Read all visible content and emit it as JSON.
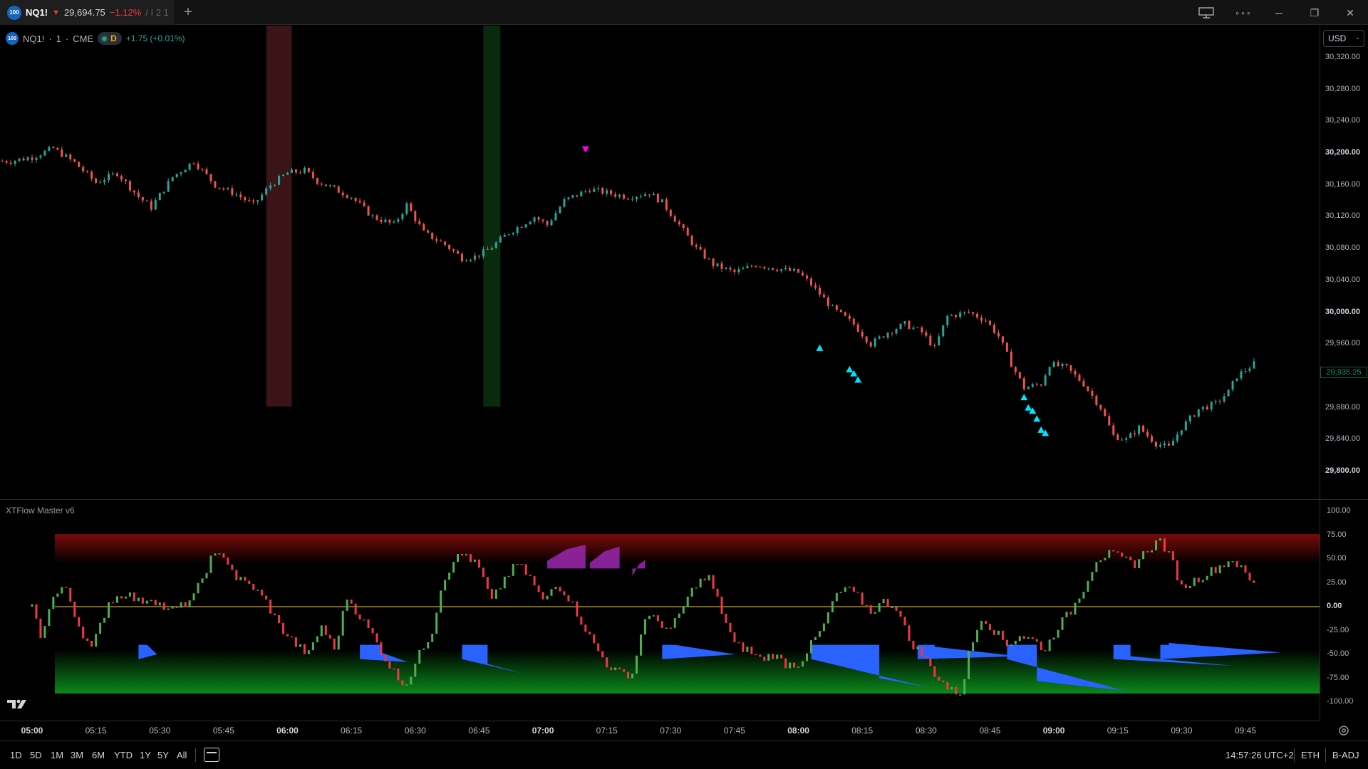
{
  "tab": {
    "badge": "100",
    "symbol": "NQ1!",
    "arrow": "▼",
    "price": "29,694.75",
    "change_pct": "−1.12%",
    "extra": "/ I 2 1"
  },
  "window_controls": {
    "new_tab": "+",
    "minimize": "─",
    "restore": "❐",
    "close": "✕",
    "more": "∘∘∘"
  },
  "legend": {
    "badge": "100",
    "symbol": "NQ1!",
    "interval": "1",
    "exchange": "CME",
    "sep": "·",
    "session_letter": "D",
    "change": "+1.75 (+0.01%)"
  },
  "currency": "USD",
  "price_axis": {
    "ticks": [
      "30,320.00",
      "30,280.00",
      "30,240.00",
      "30,200.00",
      "30,160.00",
      "30,120.00",
      "30,080.00",
      "30,040.00",
      "30,000.00",
      "29,960.00",
      "29,920.00",
      "29,880.00",
      "29,840.00",
      "29,800.00"
    ],
    "bold": [
      "30,200.00",
      "30,000.00",
      "29,800.00"
    ],
    "last_price": "29,935.25"
  },
  "indicator": {
    "title": "XTFlow Master v6",
    "ticks": [
      "100.00",
      "75.00",
      "50.00",
      "25.00",
      "0.00",
      "-25.00",
      "-50.00",
      "-75.00",
      "-100.00"
    ]
  },
  "time_axis": {
    "labels": [
      "05:00",
      "05:15",
      "05:30",
      "05:45",
      "06:00",
      "06:15",
      "06:30",
      "06:45",
      "07:00",
      "07:15",
      "07:30",
      "07:45",
      "08:00",
      "08:15",
      "08:30",
      "08:45",
      "09:00",
      "09:15",
      "09:30",
      "09:45"
    ],
    "bold": [
      "05:00",
      "06:00",
      "07:00",
      "08:00",
      "09:00"
    ]
  },
  "ranges": [
    "1D",
    "5D",
    "1M",
    "3M",
    "6M",
    "YTD",
    "1Y",
    "5Y",
    "All"
  ],
  "status": {
    "clock": "14:57:26 UTC+2",
    "session": "ETH",
    "adjust": "B-ADJ"
  },
  "chart_data": {
    "type": "candlestick",
    "symbol": "NQ1!",
    "interval": "1",
    "y_range": [
      29790,
      30330
    ],
    "x_range": [
      "05:00",
      "09:47"
    ],
    "close_path": [
      [
        "04:55",
        30190
      ],
      [
        "05:00",
        30195
      ],
      [
        "05:05",
        30206
      ],
      [
        "05:10",
        30188
      ],
      [
        "05:15",
        30163
      ],
      [
        "05:20",
        30175
      ],
      [
        "05:25",
        30145
      ],
      [
        "05:28",
        30132
      ],
      [
        "05:33",
        30170
      ],
      [
        "05:38",
        30190
      ],
      [
        "05:43",
        30160
      ],
      [
        "05:48",
        30148
      ],
      [
        "05:52",
        30135
      ],
      [
        "05:56",
        30160
      ],
      [
        "06:00",
        30175
      ],
      [
        "06:04",
        30178
      ],
      [
        "06:07",
        30165
      ],
      [
        "06:11",
        30155
      ],
      [
        "06:15",
        30145
      ],
      [
        "06:20",
        30120
      ],
      [
        "06:25",
        30110
      ],
      [
        "06:28",
        30135
      ],
      [
        "06:32",
        30100
      ],
      [
        "06:37",
        30085
      ],
      [
        "06:41",
        30068
      ],
      [
        "06:44",
        30070
      ],
      [
        "06:47",
        30078
      ],
      [
        "06:52",
        30100
      ],
      [
        "06:58",
        30120
      ],
      [
        "07:01",
        30110
      ],
      [
        "07:05",
        30140
      ],
      [
        "07:11",
        30155
      ],
      [
        "07:15",
        30150
      ],
      [
        "07:20",
        30145
      ],
      [
        "07:25",
        30150
      ],
      [
        "07:28",
        30138
      ],
      [
        "07:32",
        30110
      ],
      [
        "07:36",
        30080
      ],
      [
        "07:40",
        30060
      ],
      [
        "07:45",
        30050
      ],
      [
        "07:50",
        30060
      ],
      [
        "07:55",
        30055
      ],
      [
        "08:00",
        30050
      ],
      [
        "08:03",
        30035
      ],
      [
        "08:08",
        30005
      ],
      [
        "08:13",
        29985
      ],
      [
        "08:17",
        29960
      ],
      [
        "08:21",
        29975
      ],
      [
        "08:25",
        29985
      ],
      [
        "08:29",
        29975
      ],
      [
        "08:32",
        29955
      ],
      [
        "08:35",
        29995
      ],
      [
        "08:40",
        30000
      ],
      [
        "08:44",
        29990
      ],
      [
        "08:47",
        29970
      ],
      [
        "08:50",
        29935
      ],
      [
        "08:53",
        29905
      ],
      [
        "08:57",
        29910
      ],
      [
        "08:59",
        29935
      ],
      [
        "09:03",
        29930
      ],
      [
        "09:07",
        29910
      ],
      [
        "09:11",
        29880
      ],
      [
        "09:14",
        29845
      ],
      [
        "09:17",
        29840
      ],
      [
        "09:20",
        29855
      ],
      [
        "09:24",
        29835
      ],
      [
        "09:27",
        29830
      ],
      [
        "09:30",
        29855
      ],
      [
        "09:34",
        29878
      ],
      [
        "09:38",
        29885
      ],
      [
        "09:41",
        29900
      ],
      [
        "09:43",
        29920
      ],
      [
        "09:47",
        29935
      ]
    ],
    "session_highlights": [
      {
        "from": "05:55",
        "to": "06:01",
        "color": "#3a1416"
      },
      {
        "from": "06:46",
        "to": "06:50",
        "color": "#0a2a10"
      }
    ],
    "markers": [
      {
        "time": "07:10",
        "price": 30205,
        "shape": "triangle-down",
        "color": "#ff00ff"
      },
      {
        "time": "08:05",
        "price": 29955,
        "shape": "triangle-up",
        "color": "#00e5ff"
      },
      {
        "time": "08:12",
        "price": 29928,
        "shape": "triangle-up",
        "color": "#00e5ff"
      },
      {
        "time": "08:13",
        "price": 29923,
        "shape": "triangle-up",
        "color": "#00e5ff"
      },
      {
        "time": "08:14",
        "price": 29915,
        "shape": "triangle-up",
        "color": "#00e5ff"
      },
      {
        "time": "08:53",
        "price": 29893,
        "shape": "triangle-up",
        "color": "#00e5ff"
      },
      {
        "time": "08:54",
        "price": 29880,
        "shape": "triangle-up",
        "color": "#00e5ff"
      },
      {
        "time": "08:55",
        "price": 29876,
        "shape": "triangle-up",
        "color": "#00e5ff"
      },
      {
        "time": "08:56",
        "price": 29866,
        "shape": "triangle-up",
        "color": "#00e5ff"
      },
      {
        "time": "08:57",
        "price": 29852,
        "shape": "triangle-up",
        "color": "#00e5ff"
      },
      {
        "time": "08:58",
        "price": 29848,
        "shape": "triangle-up",
        "color": "#00e5ff"
      }
    ],
    "indicator": {
      "name": "XTFlow Master v6",
      "y_range": [
        -100,
        100
      ],
      "osc_path": [
        [
          "05:00",
          0
        ],
        [
          "05:02",
          -30
        ],
        [
          "05:05",
          10
        ],
        [
          "05:08",
          20
        ],
        [
          "05:11",
          -20
        ],
        [
          "05:14",
          -45
        ],
        [
          "05:18",
          5
        ],
        [
          "05:22",
          15
        ],
        [
          "05:25",
          5
        ],
        [
          "05:28",
          10
        ],
        [
          "05:32",
          -5
        ],
        [
          "05:35",
          0
        ],
        [
          "05:38",
          10
        ],
        [
          "05:42",
          50
        ],
        [
          "05:45",
          55
        ],
        [
          "05:48",
          30
        ],
        [
          "05:52",
          20
        ],
        [
          "05:55",
          5
        ],
        [
          "05:58",
          -20
        ],
        [
          "06:02",
          -40
        ],
        [
          "06:05",
          -50
        ],
        [
          "06:08",
          -20
        ],
        [
          "06:11",
          -45
        ],
        [
          "06:14",
          10
        ],
        [
          "06:17",
          -10
        ],
        [
          "06:20",
          -30
        ],
        [
          "06:23",
          -55
        ],
        [
          "06:26",
          -75
        ],
        [
          "06:28",
          -80
        ],
        [
          "06:31",
          -50
        ],
        [
          "06:34",
          -25
        ],
        [
          "06:36",
          20
        ],
        [
          "06:39",
          50
        ],
        [
          "06:42",
          55
        ],
        [
          "06:45",
          40
        ],
        [
          "06:48",
          5
        ],
        [
          "06:51",
          30
        ],
        [
          "06:54",
          45
        ],
        [
          "06:57",
          30
        ],
        [
          "07:00",
          5
        ],
        [
          "07:03",
          25
        ],
        [
          "07:06",
          10
        ],
        [
          "07:09",
          -15
        ],
        [
          "07:12",
          -40
        ],
        [
          "07:15",
          -60
        ],
        [
          "07:18",
          -70
        ],
        [
          "07:21",
          -70
        ],
        [
          "07:24",
          -10
        ],
        [
          "07:27",
          -15
        ],
        [
          "07:30",
          -25
        ],
        [
          "07:33",
          0
        ],
        [
          "07:36",
          25
        ],
        [
          "07:39",
          30
        ],
        [
          "07:42",
          -5
        ],
        [
          "07:45",
          -40
        ],
        [
          "07:48",
          -45
        ],
        [
          "07:51",
          -55
        ],
        [
          "07:54",
          -50
        ],
        [
          "07:57",
          -60
        ],
        [
          "08:00",
          -60
        ],
        [
          "08:03",
          -40
        ],
        [
          "08:06",
          -20
        ],
        [
          "08:08",
          5
        ],
        [
          "08:11",
          20
        ],
        [
          "08:14",
          10
        ],
        [
          "08:17",
          -5
        ],
        [
          "08:20",
          5
        ],
        [
          "08:23",
          0
        ],
        [
          "08:26",
          -35
        ],
        [
          "08:29",
          -50
        ],
        [
          "08:32",
          -70
        ],
        [
          "08:35",
          -85
        ],
        [
          "08:38",
          -95
        ],
        [
          "08:40",
          -50
        ],
        [
          "08:43",
          -10
        ],
        [
          "08:46",
          -25
        ],
        [
          "08:49",
          -40
        ],
        [
          "08:52",
          -30
        ],
        [
          "08:55",
          -35
        ],
        [
          "08:58",
          -45
        ],
        [
          "09:01",
          -20
        ],
        [
          "09:04",
          -5
        ],
        [
          "09:07",
          20
        ],
        [
          "09:10",
          50
        ],
        [
          "09:13",
          55
        ],
        [
          "09:16",
          50
        ],
        [
          "09:19",
          45
        ],
        [
          "09:22",
          60
        ],
        [
          "09:25",
          70
        ],
        [
          "09:28",
          45
        ],
        [
          "09:30",
          20
        ]
      ],
      "top_zone_color": "#7a0a0a",
      "bottom_zone_color": "#0a8a1a",
      "zero_line_color": "#c9a227",
      "bearish_fill_color": "#9c27b0",
      "bullish_fill_color": "#2962ff"
    }
  }
}
